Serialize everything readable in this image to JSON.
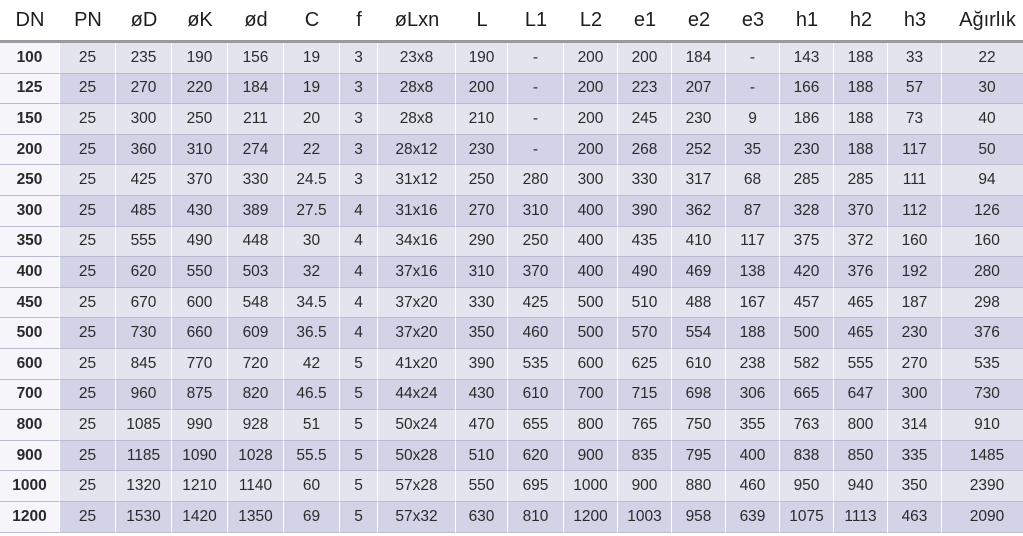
{
  "headers": [
    "DN",
    "PN",
    "øD",
    "øK",
    "ød",
    "C",
    "f",
    "øLxn",
    "L",
    "L1",
    "L2",
    "e1",
    "e2",
    "e3",
    "h1",
    "h2",
    "h3",
    "Ağırlık"
  ],
  "rows": [
    [
      "100",
      "25",
      "235",
      "190",
      "156",
      "19",
      "3",
      "23x8",
      "190",
      "-",
      "200",
      "200",
      "184",
      "-",
      "143",
      "188",
      "33",
      "22"
    ],
    [
      "125",
      "25",
      "270",
      "220",
      "184",
      "19",
      "3",
      "28x8",
      "200",
      "-",
      "200",
      "223",
      "207",
      "-",
      "166",
      "188",
      "57",
      "30"
    ],
    [
      "150",
      "25",
      "300",
      "250",
      "211",
      "20",
      "3",
      "28x8",
      "210",
      "-",
      "200",
      "245",
      "230",
      "9",
      "186",
      "188",
      "73",
      "40"
    ],
    [
      "200",
      "25",
      "360",
      "310",
      "274",
      "22",
      "3",
      "28x12",
      "230",
      "-",
      "200",
      "268",
      "252",
      "35",
      "230",
      "188",
      "117",
      "50"
    ],
    [
      "250",
      "25",
      "425",
      "370",
      "330",
      "24.5",
      "3",
      "31x12",
      "250",
      "280",
      "300",
      "330",
      "317",
      "68",
      "285",
      "285",
      "111",
      "94"
    ],
    [
      "300",
      "25",
      "485",
      "430",
      "389",
      "27.5",
      "4",
      "31x16",
      "270",
      "310",
      "400",
      "390",
      "362",
      "87",
      "328",
      "370",
      "112",
      "126"
    ],
    [
      "350",
      "25",
      "555",
      "490",
      "448",
      "30",
      "4",
      "34x16",
      "290",
      "250",
      "400",
      "435",
      "410",
      "117",
      "375",
      "372",
      "160",
      "160"
    ],
    [
      "400",
      "25",
      "620",
      "550",
      "503",
      "32",
      "4",
      "37x16",
      "310",
      "370",
      "400",
      "490",
      "469",
      "138",
      "420",
      "376",
      "192",
      "280"
    ],
    [
      "450",
      "25",
      "670",
      "600",
      "548",
      "34.5",
      "4",
      "37x20",
      "330",
      "425",
      "500",
      "510",
      "488",
      "167",
      "457",
      "465",
      "187",
      "298"
    ],
    [
      "500",
      "25",
      "730",
      "660",
      "609",
      "36.5",
      "4",
      "37x20",
      "350",
      "460",
      "500",
      "570",
      "554",
      "188",
      "500",
      "465",
      "230",
      "376"
    ],
    [
      "600",
      "25",
      "845",
      "770",
      "720",
      "42",
      "5",
      "41x20",
      "390",
      "535",
      "600",
      "625",
      "610",
      "238",
      "582",
      "555",
      "270",
      "535"
    ],
    [
      "700",
      "25",
      "960",
      "875",
      "820",
      "46.5",
      "5",
      "44x24",
      "430",
      "610",
      "700",
      "715",
      "698",
      "306",
      "665",
      "647",
      "300",
      "730"
    ],
    [
      "800",
      "25",
      "1085",
      "990",
      "928",
      "51",
      "5",
      "50x24",
      "470",
      "655",
      "800",
      "765",
      "750",
      "355",
      "763",
      "800",
      "314",
      "910"
    ],
    [
      "900",
      "25",
      "1185",
      "1090",
      "1028",
      "55.5",
      "5",
      "50x28",
      "510",
      "620",
      "900",
      "835",
      "795",
      "400",
      "838",
      "850",
      "335",
      "1485"
    ],
    [
      "1000",
      "25",
      "1320",
      "1210",
      "1140",
      "60",
      "5",
      "57x28",
      "550",
      "695",
      "1000",
      "900",
      "880",
      "460",
      "950",
      "940",
      "350",
      "2390"
    ],
    [
      "1200",
      "25",
      "1530",
      "1420",
      "1350",
      "69",
      "5",
      "57x32",
      "630",
      "810",
      "1200",
      "1003",
      "958",
      "639",
      "1075",
      "1113",
      "463",
      "2090"
    ]
  ]
}
